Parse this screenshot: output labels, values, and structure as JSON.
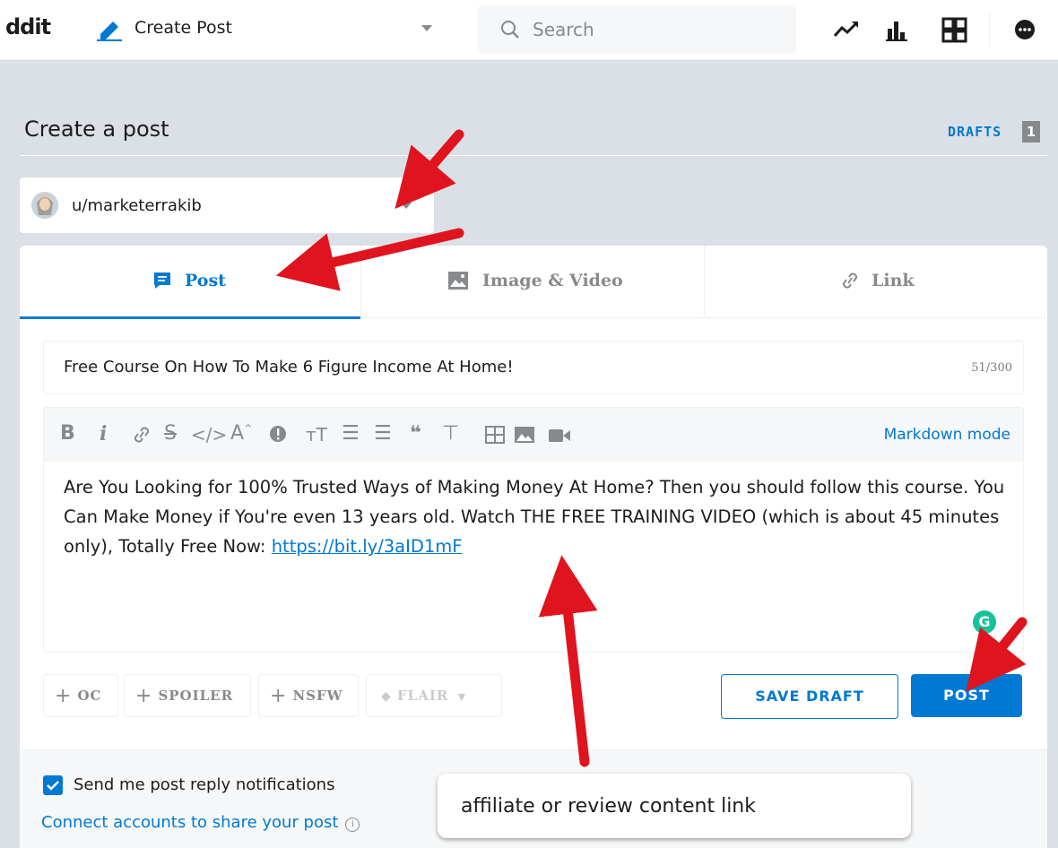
{
  "topbar": {
    "logo_text": "ddit",
    "create_post_label": "Create Post",
    "search_placeholder": "Search",
    "icons": [
      "trending-icon",
      "stats-icon",
      "coins-icon",
      "chat-icon"
    ]
  },
  "page": {
    "heading": "Create a post",
    "drafts_label": "DRAFTS",
    "drafts_count": "1"
  },
  "community": {
    "name": "u/marketerrakib"
  },
  "tabs": [
    {
      "label": "Post",
      "icon": "post-icon",
      "active": true
    },
    {
      "label": "Image & Video",
      "icon": "image-icon",
      "active": false
    },
    {
      "label": "Link",
      "icon": "link-icon",
      "active": false
    }
  ],
  "title_field": {
    "value": "Free Course On How To Make 6 Figure Income At Home!",
    "char_count": "51/300"
  },
  "editor": {
    "markdown_mode_label": "Markdown mode",
    "toolbar": [
      "bold",
      "italic",
      "link",
      "strikethrough",
      "code",
      "superscript",
      "spoiler",
      "heading",
      "bulleted-list",
      "numbered-list",
      "quote-block",
      "code-block",
      "table",
      "image",
      "video"
    ],
    "body_text": "Are You Looking for 100% Trusted Ways of Making Money At Home? Then you should follow this course. You Can Make Money if You're even 13 years old. Watch THE FREE TRAINING VIDEO (which is about 45 minutes only), Totally Free Now: ",
    "body_link": "https://bit.ly/3aID1mF"
  },
  "tags": {
    "oc": "OC",
    "spoiler": "SPOILER",
    "nsfw": "NSFW",
    "flair": "FLAIR"
  },
  "actions": {
    "save_draft": "SAVE DRAFT",
    "post": "POST"
  },
  "footer": {
    "notifications_label": "Send me post reply notifications",
    "notifications_checked": true,
    "connect_label": "Connect accounts to share your post"
  },
  "annotation": {
    "callout_text": "affiliate or review content link"
  },
  "colors": {
    "accent": "#0079d3",
    "arrow": "#e0141e",
    "background": "#dae0e6"
  }
}
